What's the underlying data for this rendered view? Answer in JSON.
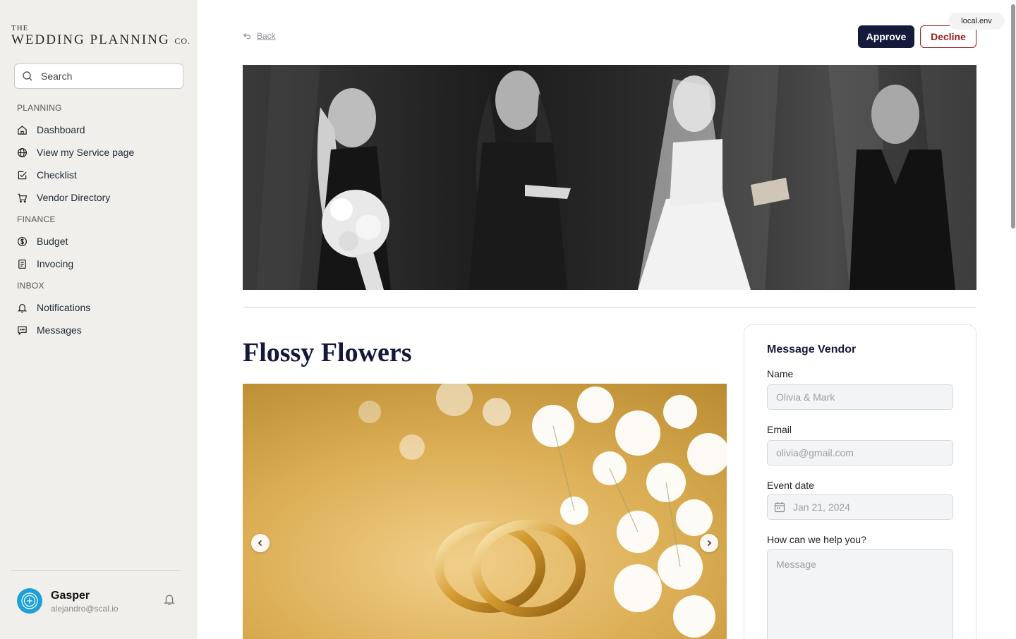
{
  "brand": {
    "small": "THE",
    "main": "WEDDING PLANNING",
    "suffix": "CO."
  },
  "search": {
    "placeholder": "Search"
  },
  "sidebar": {
    "sections": [
      {
        "label": "PLANNING",
        "items": [
          {
            "label": "Dashboard",
            "icon": "home-icon"
          },
          {
            "label": "View my Service page",
            "icon": "globe-icon"
          },
          {
            "label": "Checklist",
            "icon": "checkbox-icon"
          },
          {
            "label": "Vendor Directory",
            "icon": "cart-icon"
          }
        ]
      },
      {
        "label": "FINANCE",
        "items": [
          {
            "label": "Budget",
            "icon": "dollar-circle-icon"
          },
          {
            "label": "Invocing",
            "icon": "document-icon"
          }
        ]
      },
      {
        "label": "INBOX",
        "items": [
          {
            "label": "Notifications",
            "icon": "bell-icon"
          },
          {
            "label": "Messages",
            "icon": "message-icon"
          }
        ]
      }
    ]
  },
  "user": {
    "name": "Gasper",
    "email": "alejandro@scal.io"
  },
  "env_badge": "local.env",
  "header": {
    "back_label": "Back",
    "approve_label": "Approve",
    "decline_label": "Decline"
  },
  "vendor": {
    "name": "Flossy Flowers"
  },
  "form": {
    "title": "Message Vendor",
    "name_label": "Name",
    "name_placeholder": "Olivia & Mark",
    "email_label": "Email",
    "email_placeholder": "olivia@gmail.com",
    "date_label": "Event date",
    "date_placeholder": "Jan 21, 2024",
    "message_label": "How can we help you?",
    "message_placeholder": "Message"
  },
  "colors": {
    "sidebar_bg": "#f0efeb",
    "primary": "#151a3a",
    "danger": "#9b1c1c",
    "avatar": "#1da0d8"
  }
}
